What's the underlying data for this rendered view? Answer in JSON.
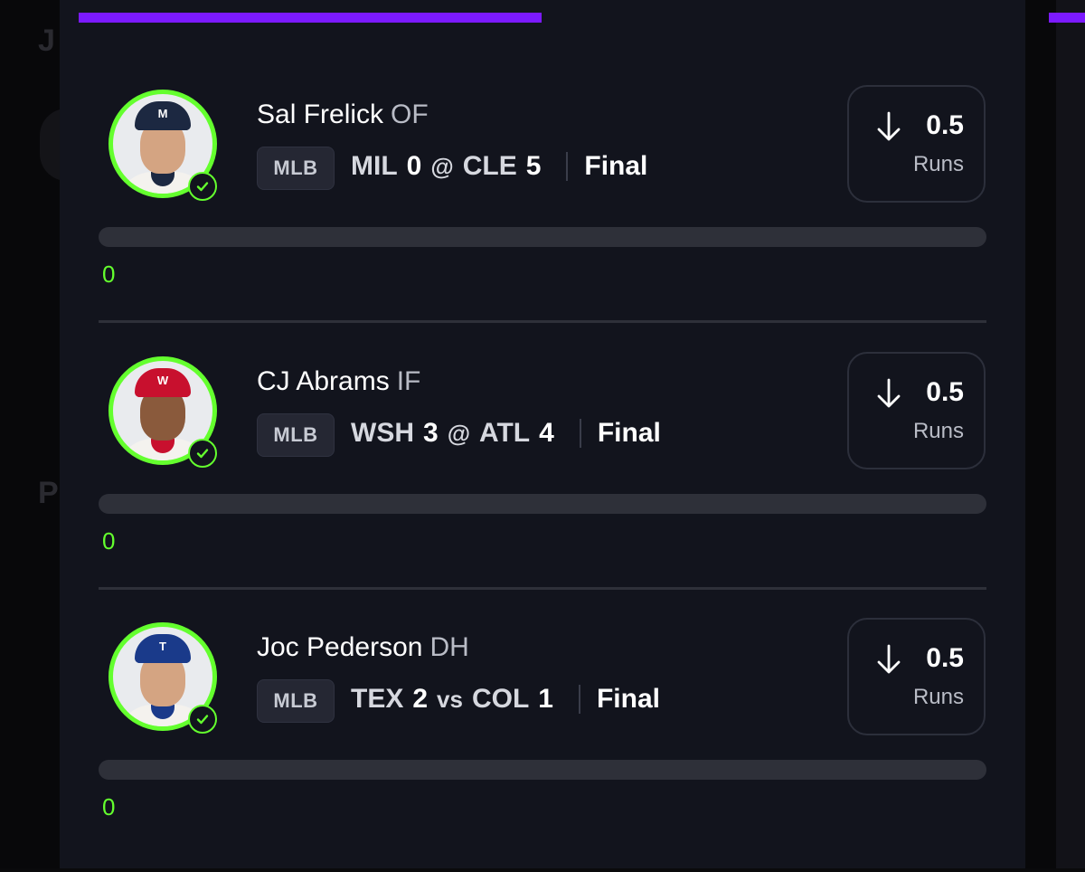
{
  "colors": {
    "accent_purple": "#7c1aff",
    "accent_green": "#64ff2e",
    "panel_bg": "#12141d"
  },
  "progress": {
    "fraction": 0.51
  },
  "picks": [
    {
      "name": "Sal Frelick",
      "position": "OF",
      "league": "MLB",
      "team_a": "MIL",
      "score_a": "0",
      "separator": "@",
      "team_b": "CLE",
      "score_b": "5",
      "status": "Final",
      "direction": "arrow-down-icon",
      "line": "0.5",
      "stat": "Runs",
      "current": "0",
      "current_fraction": 0,
      "cap_color": "#1c2841",
      "cap_logo": "M",
      "trim_color": "#1c2841"
    },
    {
      "name": "CJ Abrams",
      "position": "IF",
      "league": "MLB",
      "team_a": "WSH",
      "score_a": "3",
      "separator": "@",
      "team_b": "ATL",
      "score_b": "4",
      "status": "Final",
      "direction": "arrow-down-icon",
      "line": "0.5",
      "stat": "Runs",
      "current": "0",
      "current_fraction": 0,
      "cap_color": "#c8102e",
      "cap_logo": "W",
      "trim_color": "#c8102e"
    },
    {
      "name": "Joc Pederson",
      "position": "DH",
      "league": "MLB",
      "team_a": "TEX",
      "score_a": "2",
      "separator": "vs",
      "team_b": "COL",
      "score_b": "1",
      "status": "Final",
      "direction": "arrow-down-icon",
      "line": "0.5",
      "stat": "Runs",
      "current": "0",
      "current_fraction": 0,
      "cap_color": "#1a3a8a",
      "cap_logo": "T",
      "trim_color": "#1a3a8a"
    }
  ]
}
